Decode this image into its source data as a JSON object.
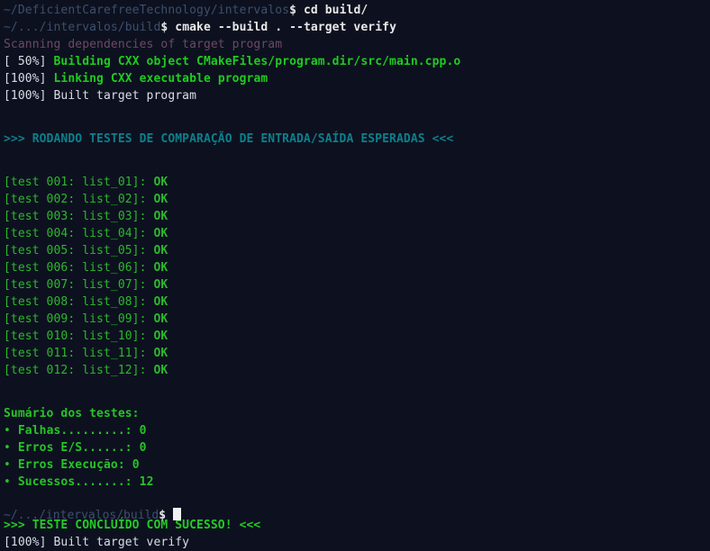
{
  "terminal": {
    "background_color": "#0d111f",
    "colors": {
      "path": "#3d4f6d",
      "command": "#e8e8e8",
      "scanning": "#6b4a63",
      "progress_marker": "#d8dde8",
      "build_message": "#1ecc1e",
      "banner_teal": "#0d7f8c",
      "test_green": "#2cb82c",
      "success_green": "#22cc22",
      "cursor": "#f2f2f2"
    },
    "prompts": [
      {
        "path": "~/DeficientCarefreeTechnology/intervalos",
        "symbol": "$",
        "command": "cd build/"
      },
      {
        "path": "~/.../intervalos/build",
        "symbol": "$",
        "command": "cmake --build . --target verify"
      }
    ],
    "scanning_line": "Scanning dependencies of target program",
    "build_steps": [
      {
        "marker": "[ 50%]",
        "message": "Building CXX object CMakeFiles/program.dir/src/main.cpp.o",
        "style": "bold"
      },
      {
        "marker": "[100%]",
        "message": "Linking CXX executable program",
        "style": "bold"
      },
      {
        "marker": "[100%]",
        "message": "Built target program",
        "style": "plain"
      }
    ],
    "test_banner": ">>> RODANDO TESTES DE COMPARAÇÃO DE ENTRADA/SAÍDA ESPERADAS <<<",
    "tests": [
      {
        "prefix": "[test 001: list_01]:",
        "result": "OK"
      },
      {
        "prefix": "[test 002: list_02]:",
        "result": "OK"
      },
      {
        "prefix": "[test 003: list_03]:",
        "result": "OK"
      },
      {
        "prefix": "[test 004: list_04]:",
        "result": "OK"
      },
      {
        "prefix": "[test 005: list_05]:",
        "result": "OK"
      },
      {
        "prefix": "[test 006: list_06]:",
        "result": "OK"
      },
      {
        "prefix": "[test 007: list_07]:",
        "result": "OK"
      },
      {
        "prefix": "[test 008: list_08]:",
        "result": "OK"
      },
      {
        "prefix": "[test 009: list_09]:",
        "result": "OK"
      },
      {
        "prefix": "[test 010: list_10]:",
        "result": "OK"
      },
      {
        "prefix": "[test 011: list_11]:",
        "result": "OK"
      },
      {
        "prefix": "[test 012: list_12]:",
        "result": "OK"
      }
    ],
    "summary": {
      "heading": "Sumário dos testes:",
      "bullet_glyph": "•",
      "rows": [
        {
          "label": "Falhas.........:",
          "value": "0"
        },
        {
          "label": "Erros E/S......:",
          "value": "0"
        },
        {
          "label": "Erros Execução:",
          "value": "0"
        },
        {
          "label": "Sucessos.......:",
          "value": "12"
        }
      ]
    },
    "success_banner": ">>> TESTE CONCLUÍDO COM SUCESSO! <<<",
    "final_step": {
      "marker": "[100%]",
      "message": "Built target verify"
    },
    "tail_prompt": {
      "path": "~/.../intervalos/build",
      "symbol": "$"
    }
  }
}
